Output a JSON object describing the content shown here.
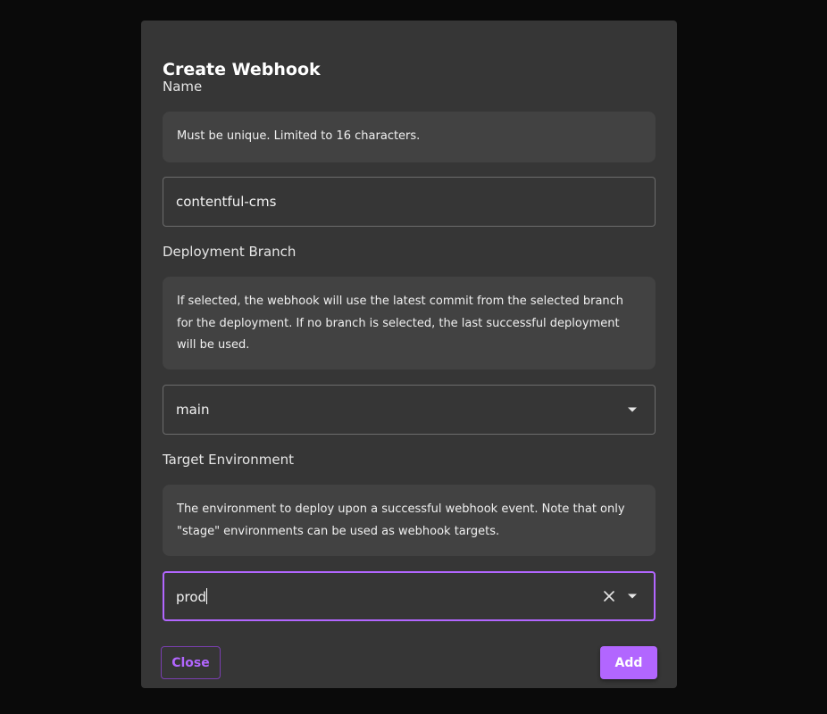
{
  "dialog": {
    "title": "Create Webhook",
    "name_field": {
      "label": "Name",
      "help": "Must be unique. Limited to 16 characters.",
      "value": "contentful-cms"
    },
    "branch_field": {
      "label": "Deployment Branch",
      "help": "If selected, the webhook will use the latest commit from the selected branch for the deployment. If no branch is selected, the last successful deployment will be used.",
      "value": "main",
      "icon": "chevron-down-icon"
    },
    "environment_field": {
      "label": "Target Environment",
      "help": "The environment to deploy upon a successful webhook event. Note that only \"stage\" environments can be used as webhook targets.",
      "value": "prod",
      "clear_icon": "close-icon",
      "icon": "chevron-down-icon"
    },
    "actions": {
      "close_label": "Close",
      "add_label": "Add"
    }
  },
  "colors": {
    "accent": "#b266ff",
    "modal_bg": "#363636",
    "help_bg": "#424242",
    "page_bg": "#0a0a0a"
  }
}
